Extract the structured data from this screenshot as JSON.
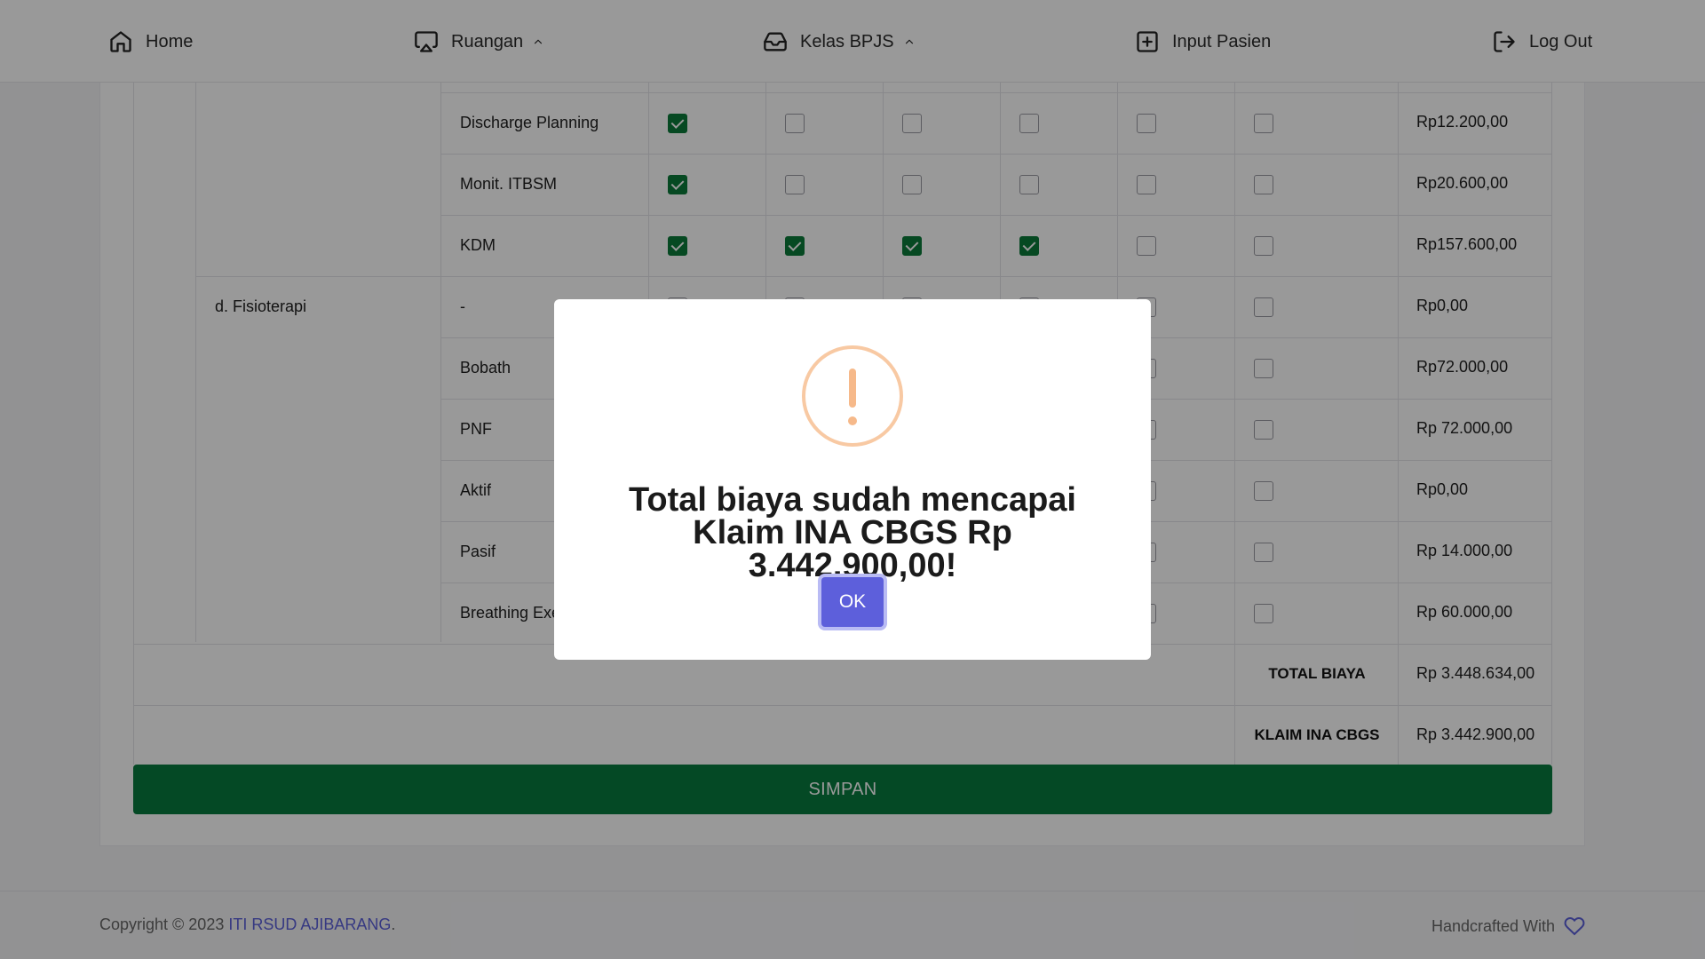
{
  "nav": {
    "home": "Home",
    "ruangan": "Ruangan",
    "kelas": "Kelas BPJS",
    "input": "Input Pasien",
    "logout": "Log Out"
  },
  "table": {
    "rows": [
      {
        "group": "",
        "item": "Discharge Planning",
        "checks": [
          true,
          false,
          false,
          false,
          false,
          false
        ],
        "price": "Rp12.200,00"
      },
      {
        "group": "",
        "item": "Monit. ITBSM",
        "checks": [
          true,
          false,
          false,
          false,
          false,
          false
        ],
        "price": "Rp20.600,00"
      },
      {
        "group": "",
        "item": "KDM",
        "checks": [
          true,
          true,
          true,
          true,
          false,
          false
        ],
        "price": "Rp157.600,00"
      },
      {
        "group": "d. Fisioterapi",
        "item": "-",
        "checks": [
          false,
          false,
          false,
          false,
          false,
          false
        ],
        "price": "Rp0,00"
      },
      {
        "group": "",
        "item": "Bobath",
        "checks": [
          false,
          false,
          false,
          false,
          false,
          false
        ],
        "price": "Rp72.000,00"
      },
      {
        "group": "",
        "item": "PNF",
        "checks": [
          false,
          false,
          false,
          false,
          false,
          false
        ],
        "price": "Rp 72.000,00"
      },
      {
        "group": "",
        "item": "Aktif",
        "checks": [
          false,
          false,
          false,
          false,
          false,
          false
        ],
        "price": "Rp0,00"
      },
      {
        "group": "",
        "item": "Pasif",
        "checks": [
          false,
          false,
          false,
          false,
          false,
          false
        ],
        "price": "Rp 14.000,00"
      },
      {
        "group": "",
        "item": "Breathing Exe",
        "checks": [
          false,
          false,
          false,
          false,
          false,
          false
        ],
        "price": "Rp 60.000,00"
      }
    ],
    "total_label": "TOTAL BIAYA",
    "total_value": "Rp 3.448.634,00",
    "klaim_label": "KLAIM INA CBGS",
    "klaim_value": "Rp 3.442.900,00"
  },
  "save_button": "SIMPAN",
  "footer": {
    "copyright": "Copyright © 2023 ",
    "brand": "ITI RSUD AJIBARANG",
    "brand_suffix": ".",
    "handcrafted": "Handcrafted With"
  },
  "modal": {
    "message": "Total biaya sudah mencapai Klaim INA CBGS Rp 3.442.900,00!",
    "ok": "OK"
  },
  "colors": {
    "checked": "#0a7a3a",
    "save_button": "#087b3e",
    "ok_button": "#5d5fdb",
    "warning": "#f6b98a",
    "brand_link": "#5b5fd9"
  }
}
